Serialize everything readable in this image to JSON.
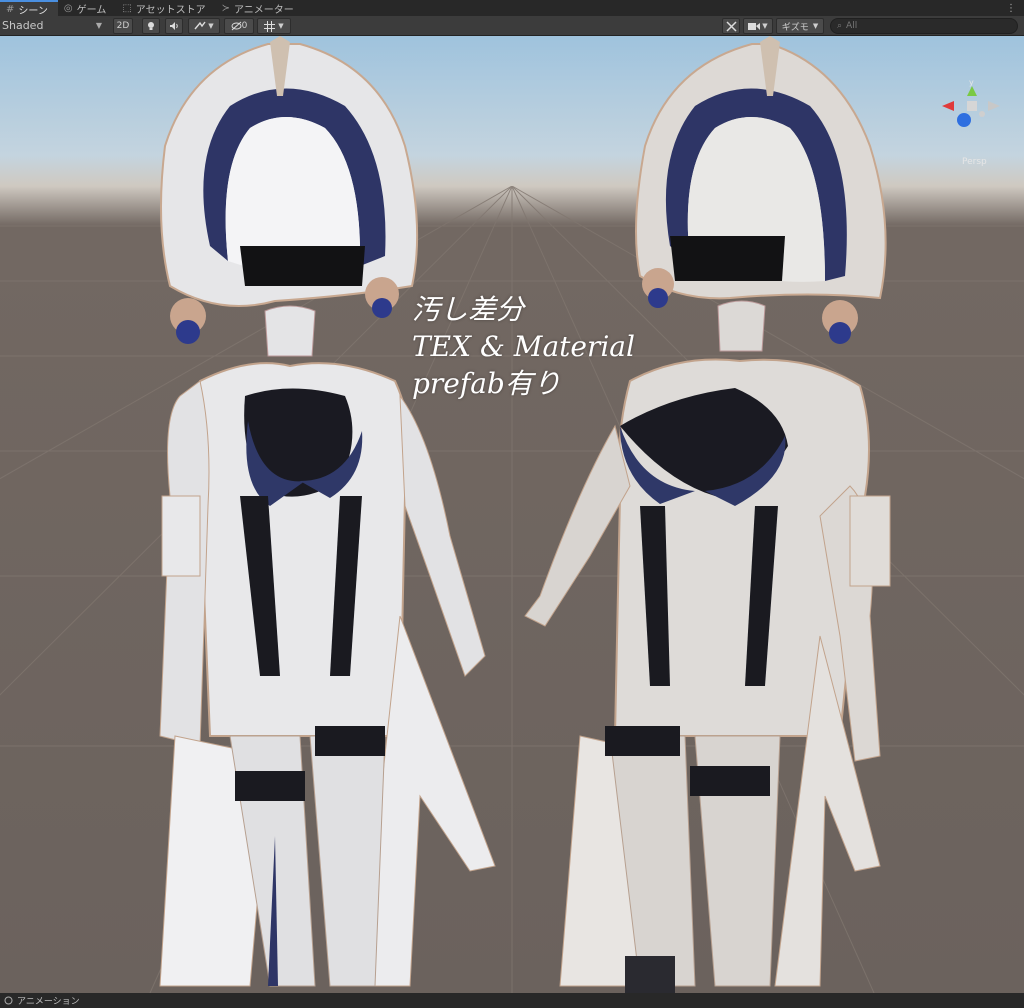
{
  "tabs": [
    {
      "icon": "#",
      "label": "シーン",
      "active": true
    },
    {
      "icon": "◎",
      "label": "ゲーム",
      "active": false
    },
    {
      "icon": "⬚",
      "label": "アセットストア",
      "active": false
    },
    {
      "icon": "≻",
      "label": "アニメーター",
      "active": false
    }
  ],
  "tab_menu": "⋮",
  "toolbar": {
    "draw_mode": "Shaded",
    "toggle_2d": "2D",
    "effects_count": "0",
    "gizmos_label": "ギズモ",
    "search_placeholder": "All"
  },
  "overlay_text": {
    "line1": "汚し差分",
    "line2": "TEX & Material",
    "line3": "prefab有り"
  },
  "orientation_gizmo": {
    "axis_y": "y",
    "projection_label": "Persp"
  },
  "bottom_tab": "アニメーション",
  "colors": {
    "accent": "#4a8fe0",
    "sky": "#a9c9e0",
    "ground": "#6b625d",
    "cloth_dark": "#2a2f55"
  }
}
